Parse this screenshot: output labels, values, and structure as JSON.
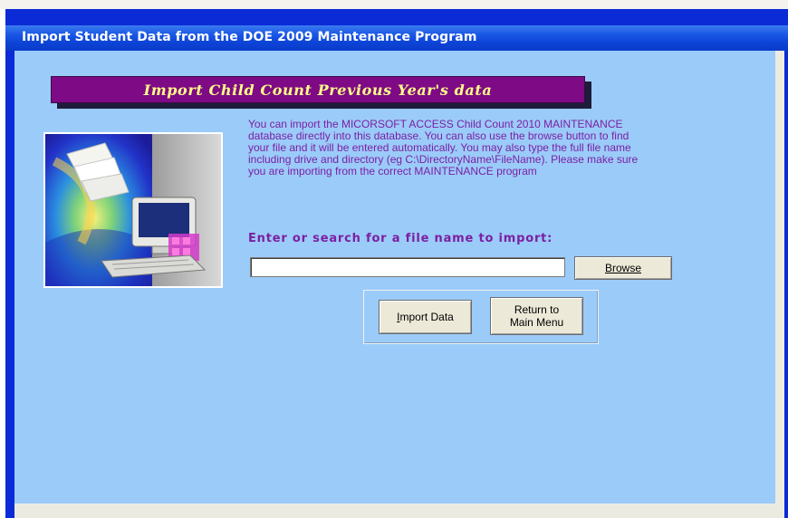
{
  "window": {
    "title": "Import Student Data from the DOE 2009  Maintenance Program"
  },
  "form": {
    "banner_title": "Import Child Count Previous Year's data",
    "instructions": "You can import the MICORSOFT ACCESS Child Count 2010 MAINTENANCE database directly into this database.  You can also use the browse button to find your file and it will be entered automatically.  You may also type the full file name including drive and directory (eg C:\\DirectoryName\\FileName).  Please make sure you are importing from the correct MAINTENANCE program",
    "prompt_label": "Enter or search for a file name to import:",
    "file_input_value": "",
    "browse_label": "Browse",
    "import_label_ul": "I",
    "import_label_rest": "mport Data",
    "return_label_line1": "Return to",
    "return_label_line2": "Main Menu"
  },
  "colors": {
    "form_background": "#9bcbf9",
    "banner_background": "#7e0a86",
    "banner_text": "#ffff88",
    "instruction_text": "#7b1fa3",
    "titlebar": "#0d45d8"
  },
  "icons": [
    "computer-illustration",
    "paper-stack-icon",
    "monitor-icon",
    "keyboard-icon"
  ]
}
